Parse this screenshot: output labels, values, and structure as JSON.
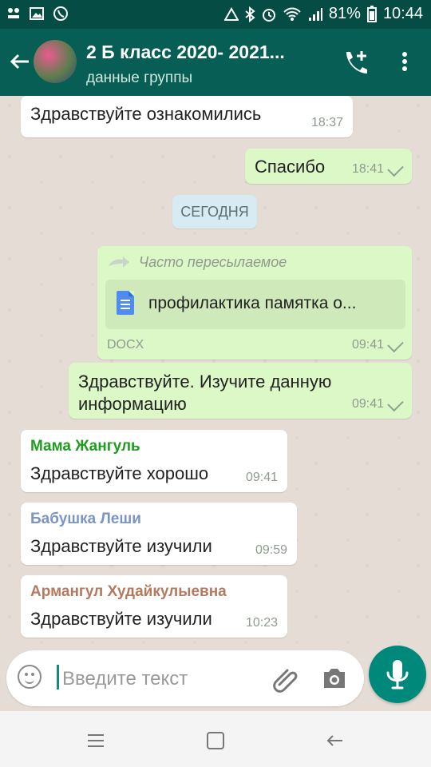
{
  "status": {
    "battery": "81%",
    "time": "10:44"
  },
  "chat_header": {
    "title": "2 Б класс 2020- 2021...",
    "subtitle": "данные группы"
  },
  "messages": [
    {
      "type": "in",
      "text": "Здравствуйте ознакомились",
      "time": "18:37"
    },
    {
      "type": "out",
      "text": "Спасибо",
      "time": "18:41"
    },
    {
      "type": "day",
      "text": "СЕГОДНЯ"
    },
    {
      "type": "out_file",
      "forward_label": "Часто пересылаемое",
      "file_name": "профилактика памятка о...",
      "file_type": "DOCX",
      "time": "09:41"
    },
    {
      "type": "out",
      "text": "Здравствуйте. Изучите данную информацию",
      "time": "09:41"
    },
    {
      "type": "in",
      "sender": "Мама Жангуль",
      "sender_color": "#1f9d1f",
      "text": "Здравствуйте хорошо",
      "time": "09:41"
    },
    {
      "type": "in",
      "sender": "Бабушка Леши",
      "sender_color": "#7b94c6",
      "text": "Здравствуйте  изучили",
      "time": "09:59"
    },
    {
      "type": "in",
      "sender": "Армангул Худайкулыевна",
      "sender_color": "#b37a5f",
      "text": "Здравствуйте изучили",
      "time": "10:23"
    }
  ],
  "composer": {
    "placeholder": "Введите текст"
  },
  "colors": {
    "header": "#075e54",
    "status": "#054d44",
    "incoming": "#ffffff",
    "outgoing": "#dcf8c6",
    "accent": "#00897b"
  },
  "icons": [
    "back-arrow-icon",
    "add-call-icon",
    "more-vertical-icon",
    "emoji-icon",
    "attachment-icon",
    "camera-icon",
    "mic-icon"
  ]
}
